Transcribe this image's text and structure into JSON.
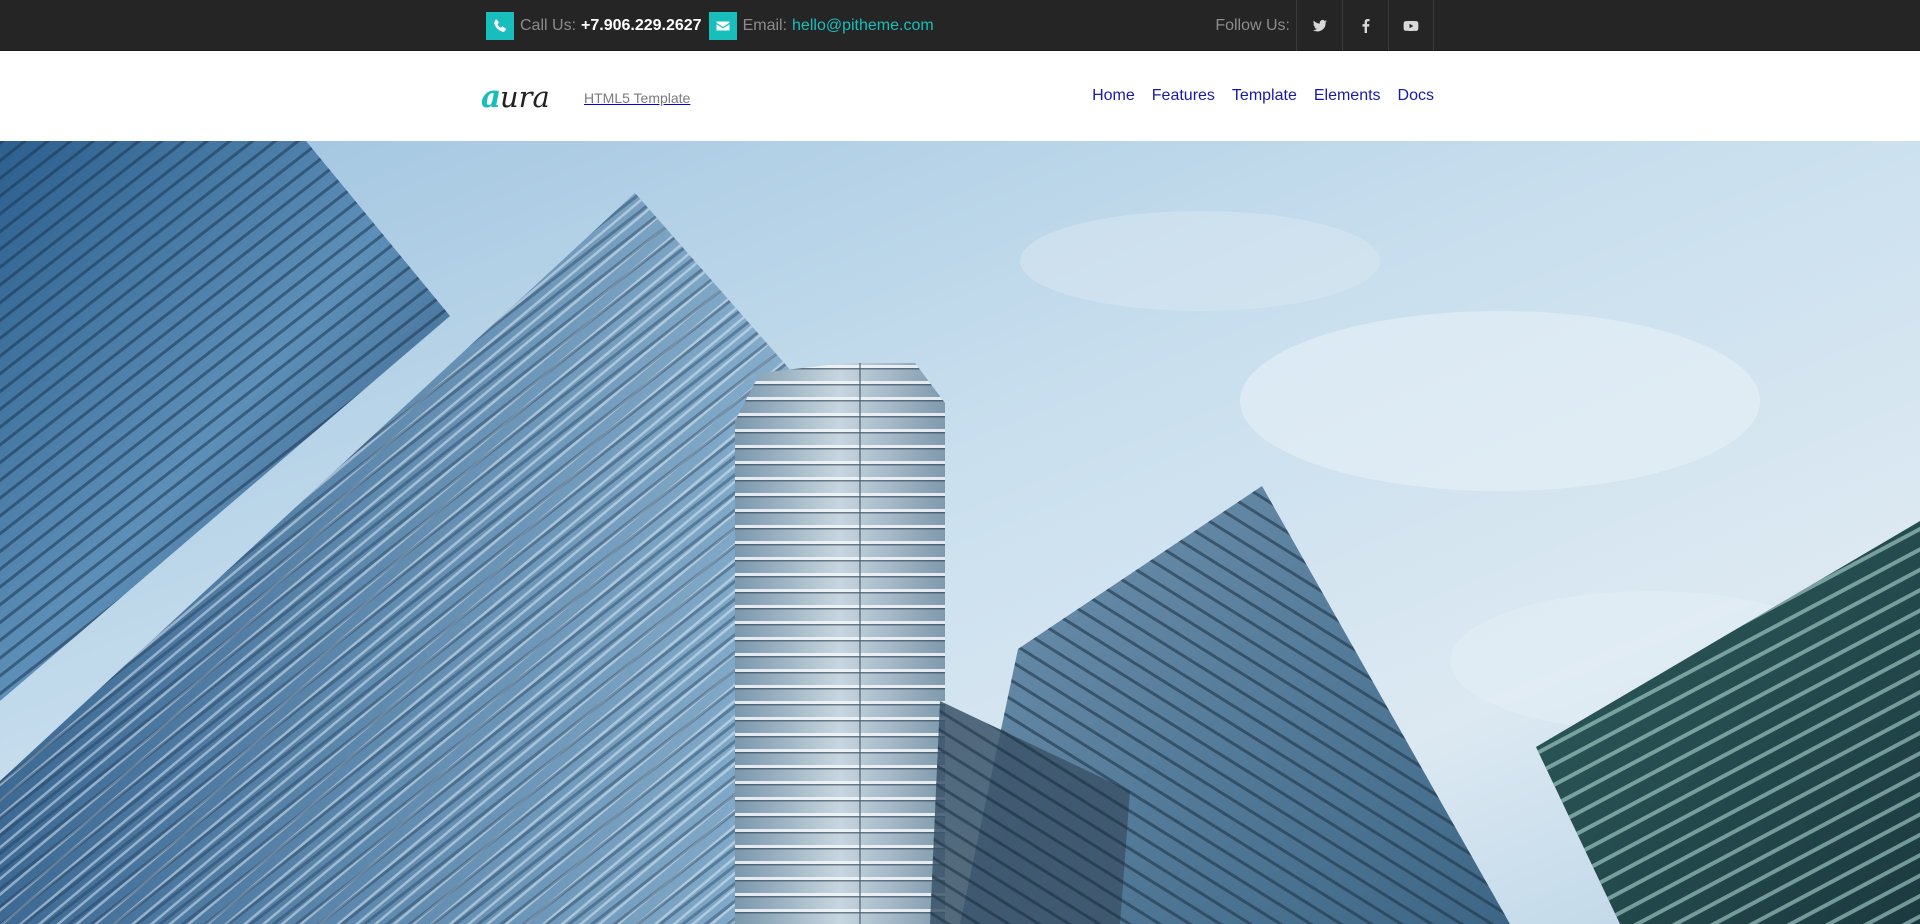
{
  "topbar": {
    "call_label": "Call Us:",
    "phone": "+7.906.229.2627",
    "email_label": "Email:",
    "email": "hello@pitheme.com",
    "follow_label": "Follow Us:",
    "social": [
      {
        "name": "twitter-icon"
      },
      {
        "name": "facebook-icon"
      },
      {
        "name": "youtube-icon"
      }
    ]
  },
  "header": {
    "logo_text": "aura",
    "tagline": "HTML5 Template",
    "nav": [
      "Home",
      "Features",
      "Template",
      "Elements",
      "Docs"
    ]
  },
  "colors": {
    "accent": "#17bebb",
    "topbar_bg": "#252525",
    "nav_link": "#1a1aa6"
  },
  "hero": {
    "image": "low-angle view of glass skyscrapers against a blue sky"
  }
}
